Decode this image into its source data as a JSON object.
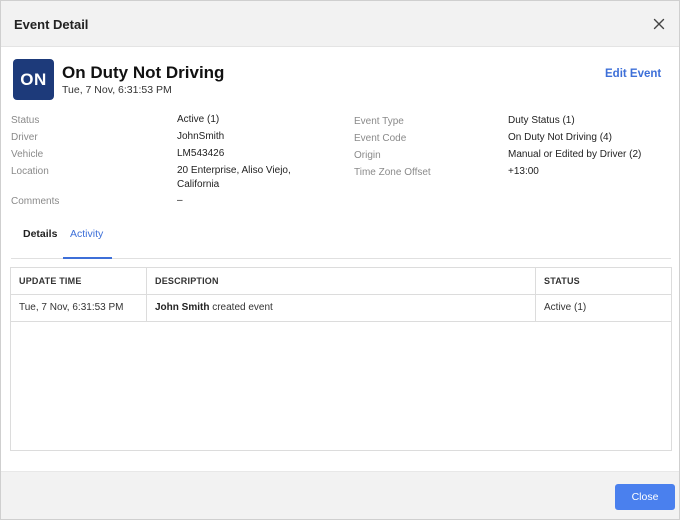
{
  "dialog": {
    "title": "Event Detail"
  },
  "event": {
    "badge": "ON",
    "title": "On Duty Not Driving",
    "timestamp": "Tue, 7 Nov, 6:31:53 PM",
    "edit_label": "Edit Event"
  },
  "details_left": [
    {
      "label": "Status",
      "value": "Active (1)"
    },
    {
      "label": "Driver",
      "value": "JohnSmith"
    },
    {
      "label": "Vehicle",
      "value": "LM543426"
    },
    {
      "label": "Location",
      "value": "20 Enterprise, Aliso Viejo, California"
    },
    {
      "label": "Comments",
      "value": "–"
    }
  ],
  "details_right": [
    {
      "label": "Event Type",
      "value": "Duty Status (1)"
    },
    {
      "label": "Event Code",
      "value": "On Duty Not Driving (4)"
    },
    {
      "label": "Origin",
      "value": "Manual or Edited by Driver (2)"
    },
    {
      "label": "Time Zone Offset",
      "value": "+13:00"
    }
  ],
  "tabs": [
    {
      "label": "Details",
      "active": false
    },
    {
      "label": "Activity",
      "active": true
    }
  ],
  "activity_table": {
    "columns": [
      "UPDATE TIME",
      "DESCRIPTION",
      "STATUS"
    ],
    "rows": [
      {
        "update_time": "Tue, 7 Nov, 6:31:53 PM",
        "actor": "John Smith",
        "action": " created event",
        "status": "Active (1)"
      }
    ]
  },
  "footer": {
    "close_label": "Close"
  },
  "colors": {
    "badge": "#1d3a7a",
    "accent": "#3d6fd8",
    "button": "#4a80ee"
  }
}
